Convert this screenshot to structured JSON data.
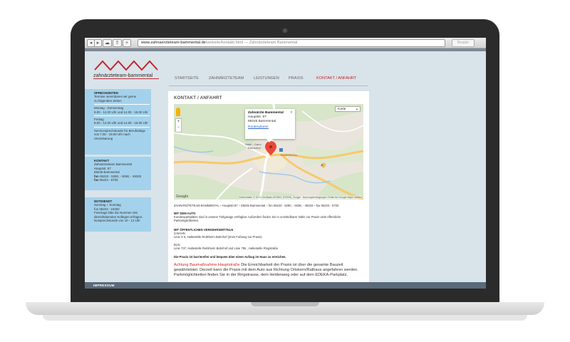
{
  "browser": {
    "url_host": "www.zahnaerzteteam-bammental.de",
    "url_rest": "/website/kontakt.html — Zahnärzteteam Bammental",
    "reader_label": "Reader",
    "back_label": "◂",
    "forward_label": "▸",
    "add_label": "+"
  },
  "logo": {
    "text": "zahnärzteteam-bammental"
  },
  "nav": {
    "items": [
      {
        "label": "STARTSEITE",
        "active": false
      },
      {
        "label": "ZAHNÄRZTETEAM",
        "active": false
      },
      {
        "label": "LEISTUNGEN",
        "active": false
      },
      {
        "label": "PRAXIS",
        "active": false
      },
      {
        "label": "KONTAKT / ANFAHRT",
        "active": true
      }
    ]
  },
  "sidebar": {
    "sprechzeiten": {
      "head": "SPRECHZEITEN",
      "intro1": "Termine vereinbaren wir gerne",
      "intro2": "zu folgenden Zeiten",
      "l1": "Montag - Donnerstag",
      "l2": "8.00 - 12.00 Uhr und 14.00 - 18.00 Uhr",
      "l3": "Freitag",
      "l4": "8.00 - 12.00 Uhr und 14.00 - 16.00 Uhr",
      "l5": "Servicesprechstunde für Berufstätige",
      "l6": "von 7.00 - 19.00 Uhr nach Vereinbarung"
    },
    "kontakt": {
      "head": "KONTAKT",
      "name": "Zahnärzteteam Bammental",
      "street": "Hauptstr. 97",
      "city": "69245 Bammental",
      "fon_label": "fon",
      "fon": "06223 - 5290, - 5038, - 49333",
      "fax_label": "fax",
      "fax": "06223 - 5703"
    },
    "notdienst": {
      "head": "NOTDIENST",
      "l1": "Sonntag + Sonntag",
      "l2": "fon 06223 - 19292",
      "l3": "Feiertags bitte die Nummer des",
      "l4": "diensthabenden Kollegen erfragen.",
      "l5": "Notsprechstunde von 10 - 12 Uhr"
    }
  },
  "content": {
    "title": "KONTAKT / ANFAHRT",
    "map": {
      "type_label": "Karte",
      "popup_title": "Zahnärzte Bammental",
      "popup_street": "Hauptstr. 97",
      "popup_city": "69245 Bammental",
      "popup_link": "Routenplaner",
      "footer": "Kartendaten © 2014 GeoBasis-DE/BKG (©2009), Google · Nutzungsbedingungen   Fehler bei Google Maps melden",
      "google": "Google",
      "zoom_in": "+",
      "zoom_out": "−",
      "label_hotel": "Hotel - Garni",
      "label_hotel2": "Elsenzhof",
      "label_bammental": "BAMMENTAL",
      "label_road": "45"
    },
    "address_line": "ZAHNÄRZTETEAM BAMMENTAL – Hauptstr.97 – 69245 Bammental – fon 06223 - 5290, - 5038, - 49333 – fax 06223 - 5703",
    "auto_head": "MIT DEM AUTO",
    "auto_text": "Kundenparkplätze sind in unserer Tiefgarage verfügbar. Außerdem finden Sie in unmittelbarer Nähe zur Praxis viele öffentliche Parkmöglichkeiten.",
    "oev_head": "MIT ÖFFENTLICHEN VERKEHRSMITTELN",
    "sbahn": "S-BAHN",
    "sbahn_text": "Linie S 5, Haltestelle Reilsheim Bahnhof (3min Fußweg zur Praxis)",
    "bus": "BUS",
    "bus_text": "Linie 737, Haltestelle Reilsheim Bahnhof und Linie 755 , Haltestelle Ringstraße",
    "barrier": "Die Praxis ist barrierefrei und bequem über einen Aufzug im Haus zu erreichen.",
    "notice_red": "Achtung Baumaßnahme Hauptstraße",
    "notice_text": "Die Erreichbarkeit der Praxis ist über die gesamte Bauzeit gewährleistet. Derzeit kann die Praxis mit dem Auto aus Richtung Ortskern/Rathaus angefahren werden. Parkmöglichkeiten finden Sie in der Ringstrasse, dem Heldenweg oder auf dem EDEKA-Parkplatz."
  },
  "footer": {
    "label": "IMPRESSUM"
  }
}
